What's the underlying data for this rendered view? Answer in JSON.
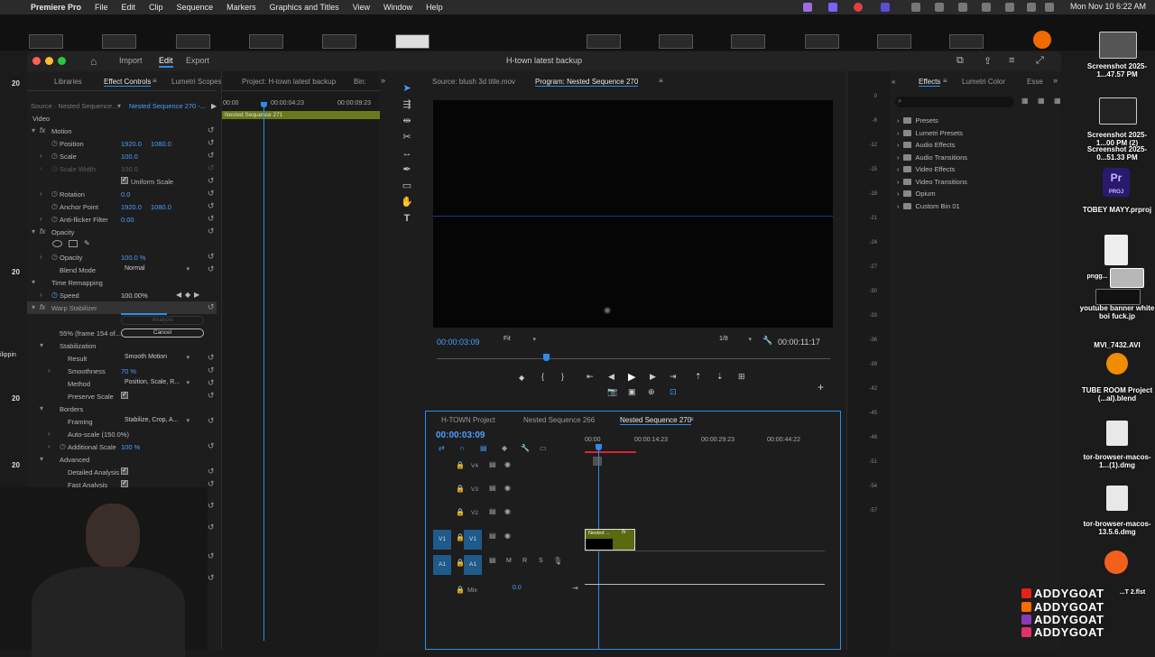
{
  "menubar": {
    "app": "Premiere Pro",
    "items": [
      "File",
      "Edit",
      "Clip",
      "Sequence",
      "Markers",
      "Graphics and Titles",
      "View",
      "Window",
      "Help"
    ],
    "clock": "Mon Nov 10  6:22 AM"
  },
  "window": {
    "title": "H-town latest backup",
    "workspaces": [
      "Import",
      "Edit",
      "Export"
    ],
    "active_workspace": "Edit"
  },
  "ec_panel": {
    "tabs": [
      "Libraries",
      "Effect Controls",
      "Lumetri Scopes",
      "Project: H-town latest backup",
      "Bin:"
    ],
    "active_tab": "Effect Controls",
    "source": "Source · Nested Sequence...",
    "sequence": "Nested Sequence 270 -...",
    "section_video": "Video",
    "motion": "Motion",
    "position": {
      "label": "Position",
      "x": "1920.0",
      "y": "1080.0"
    },
    "scale": {
      "label": "Scale",
      "value": "100.0"
    },
    "scale_width": {
      "label": "Scale Width",
      "value": "100.0"
    },
    "uniform_scale": "Uniform Scale",
    "rotation": {
      "label": "Rotation",
      "value": "0.0"
    },
    "anchor_point": {
      "label": "Anchor Point",
      "x": "1920.0",
      "y": "1080.0"
    },
    "anti_flicker": {
      "label": "Anti-flicker Filter",
      "value": "0.00"
    },
    "opacity_section": "Opacity",
    "opacity": {
      "label": "Opacity",
      "value": "100.0 %"
    },
    "blend_mode": {
      "label": "Blend Mode",
      "value": "Normal"
    },
    "time_remapping": "Time Remapping",
    "speed": {
      "label": "Speed",
      "value": "100.00%"
    },
    "warp_stabilizer": "Warp Stabilizer",
    "analyze_label": "Analyze",
    "progress_text": "55% (frame 154 of...",
    "progress_fraction": 0.55,
    "cancel": "Cancel",
    "stabilization": "Stabilization",
    "result": {
      "label": "Result",
      "value": "Smooth Motion"
    },
    "smoothness": {
      "label": "Smoothness",
      "value": "70 %"
    },
    "method": {
      "label": "Method",
      "value": "Position, Scale, R..."
    },
    "preserve_scale": "Preserve Scale",
    "borders": "Borders",
    "framing": {
      "label": "Framing",
      "value": "Stabilize, Crop, A..."
    },
    "auto_scale": "Auto-scale (150.0%)",
    "additional_scale": {
      "label": "Additional Scale",
      "value": "100 %"
    },
    "advanced": "Advanced",
    "detailed_analysis": "Detailed Analysis",
    "fast_analysis": "Fast Analysis",
    "ruler": [
      "00:00",
      "00:00:04:23",
      "00:00:09:23"
    ],
    "clip_name": "Nested Sequence 271"
  },
  "monitor": {
    "source_tab": "Source: blush 3d title.mov",
    "program_tab": "Program: Nested Sequence 270",
    "timecode": "00:00:03:09",
    "fit": "Fit",
    "resolution": "1/8",
    "duration": "00:00:11:17"
  },
  "timeline": {
    "tabs": [
      "H-TOWN Project",
      "Nested Sequence 266",
      "Nested Sequence 270"
    ],
    "active_tab": "Nested Sequence 270",
    "timecode": "00:00:03:09",
    "ruler": [
      "00:00",
      "00:00:14:23",
      "00:00:29:23",
      "00:00:44:22"
    ],
    "tracks": [
      "V4",
      "V3",
      "V2",
      "V1",
      "A1"
    ],
    "source_patch": [
      "V1",
      "A1"
    ],
    "audio_buttons": [
      "M",
      "R",
      "S"
    ],
    "mix_label": "Mix",
    "mix_value": "0.0",
    "clip_label": "Nested ...",
    "fx": "fx"
  },
  "meters": {
    "scale": [
      "0",
      "-6",
      "-12",
      "-15",
      "-18",
      "-21",
      "-24",
      "-27",
      "-30",
      "-33",
      "-36",
      "-39",
      "-42",
      "-45",
      "-48",
      "-51",
      "-54",
      "-57"
    ]
  },
  "effects": {
    "tabs": [
      "Effects",
      "Lumetri Color",
      "Esse"
    ],
    "folders": [
      "Presets",
      "Lumetri Presets",
      "Audio Effects",
      "Audio Transitions",
      "Video Effects",
      "Video Transitions",
      "Opium",
      "Custom Bin 01"
    ]
  },
  "desktop": {
    "files": [
      "Screenshot 2025-1...47.57 PM",
      "Screenshot 2025-1...00 PM (2)",
      "Screenshot 2025-0...51.33 PM",
      "TOBEY MAYY.prproj",
      "pngg...",
      "youtube banner white boi fuck.jp",
      "MVI_7432.AVI",
      "TUBE ROOM Project (...al).blend",
      "tor-browser-macos-1...(1).dmg",
      "tor-browser-macos-13.5.6.dmg",
      "...T 2.flst"
    ],
    "left_labels": [
      "20",
      "20",
      "20",
      "20",
      "ilippin"
    ],
    "pr_badge": "Pr",
    "proj_badge": "PROJ",
    "social": [
      "ADDYGOAT",
      "ADDYGOAT",
      "ADDYGOAT",
      "ADDYGOAT"
    ],
    "social_colors": [
      "#e62117",
      "#ff6a00",
      "#8a3ab9",
      "#e1306c"
    ]
  }
}
